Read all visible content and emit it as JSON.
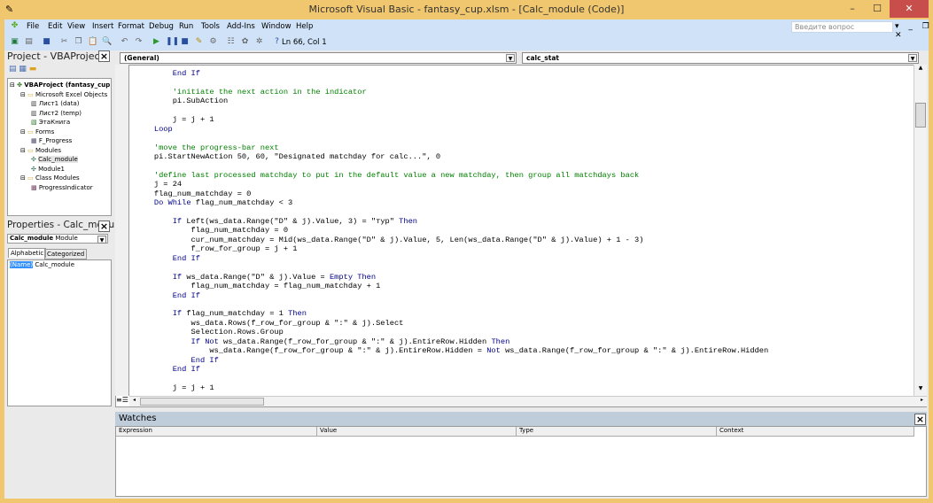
{
  "window": {
    "title": "Microsoft Visual Basic - fantasy_cup.xlsm - [Calc_module (Code)]",
    "minimize": "–",
    "maximize": "☐",
    "close": "✕"
  },
  "menu": [
    "File",
    "Edit",
    "View",
    "Insert",
    "Format",
    "Debug",
    "Run",
    "Tools",
    "Add-Ins",
    "Window",
    "Help"
  ],
  "toolbar": {
    "position": "Ln 66, Col 1",
    "icons": [
      "excel-icon",
      "insert-userform-icon",
      "save-icon",
      "cut-icon",
      "copy-icon",
      "paste-icon",
      "find-icon",
      "undo-icon",
      "redo-icon",
      "run-icon",
      "break-icon",
      "reset-icon",
      "design-mode-icon",
      "project-explorer-icon",
      "properties-icon",
      "object-browser-icon",
      "toolbox-icon",
      "help-icon"
    ]
  },
  "ask": {
    "placeholder": "Введите вопрос"
  },
  "project": {
    "title": "Project - VBAProject",
    "tree": [
      {
        "label": "VBAProject (fantasy_cup",
        "level": 0,
        "bold": true,
        "icon": "vba-project-icon"
      },
      {
        "label": "Microsoft Excel Objects",
        "level": 1,
        "icon": "folder-icon"
      },
      {
        "label": "Лист1 (data)",
        "level": 2,
        "icon": "sheet-icon"
      },
      {
        "label": "Лист2 (temp)",
        "level": 2,
        "icon": "sheet-icon"
      },
      {
        "label": "ЭтаКнига",
        "level": 2,
        "icon": "workbook-icon"
      },
      {
        "label": "Forms",
        "level": 1,
        "icon": "folder-icon"
      },
      {
        "label": "F_Progress",
        "level": 2,
        "icon": "form-icon"
      },
      {
        "label": "Modules",
        "level": 1,
        "icon": "folder-icon"
      },
      {
        "label": "Calc_module",
        "level": 2,
        "icon": "module-icon",
        "selected": true
      },
      {
        "label": "Module1",
        "level": 2,
        "icon": "module-icon"
      },
      {
        "label": "Class Modules",
        "level": 1,
        "icon": "folder-icon"
      },
      {
        "label": "ProgressIndicator",
        "level": 2,
        "icon": "class-module-icon"
      }
    ]
  },
  "properties": {
    "title": "Properties - Calc_modul",
    "object_name": "Calc_module",
    "object_type": "Module",
    "tabs": [
      "Alphabetic",
      "Categorized"
    ],
    "rows": [
      {
        "name": "(Name)",
        "value": "Calc_module"
      }
    ]
  },
  "code": {
    "object": "(General)",
    "procedure": "calc_stat",
    "lines": [
      [
        [
          "kw",
          "        End If"
        ]
      ],
      [],
      [
        [
          "cm",
          "        'initiate the next action in the indicator"
        ]
      ],
      [
        [
          "tx",
          "        pi.SubAction"
        ]
      ],
      [],
      [
        [
          "tx",
          "        j = j + 1"
        ]
      ],
      [
        [
          "kw",
          "    Loop"
        ]
      ],
      [],
      [
        [
          "cm",
          "    'move the progress-bar next"
        ]
      ],
      [
        [
          "tx",
          "    pi.StartNewAction 50, 60, \"Designated matchday for calc...\", 0"
        ]
      ],
      [],
      [
        [
          "cm",
          "    'define last processed matchday to put in the default value a new matchday, then group all matchdays back"
        ]
      ],
      [
        [
          "tx",
          "    j = 24"
        ]
      ],
      [
        [
          "tx",
          "    flag_num_matchday = 0"
        ]
      ],
      [
        [
          "kw",
          "    Do While"
        ],
        [
          "tx",
          " flag_num_matchday < 3"
        ]
      ],
      [],
      [
        [
          "kw",
          "        If"
        ],
        [
          "tx",
          " Left(ws_data.Range(\"D\" & j).Value, 3) = \"тур\" "
        ],
        [
          "kw",
          "Then"
        ]
      ],
      [
        [
          "tx",
          "            flag_num_matchday = 0"
        ]
      ],
      [
        [
          "tx",
          "            cur_num_matchday = Mid(ws_data.Range(\"D\" & j).Value, 5, Len(ws_data.Range(\"D\" & j).Value) + 1 - 3)"
        ]
      ],
      [
        [
          "tx",
          "            f_row_for_group = j + 1"
        ]
      ],
      [
        [
          "kw",
          "        End If"
        ]
      ],
      [],
      [
        [
          "kw",
          "        If"
        ],
        [
          "tx",
          " ws_data.Range(\"D\" & j).Value = "
        ],
        [
          "kw",
          "Empty Then"
        ]
      ],
      [
        [
          "tx",
          "            flag_num_matchday = flag_num_matchday + 1"
        ]
      ],
      [
        [
          "kw",
          "        End If"
        ]
      ],
      [],
      [
        [
          "kw",
          "        If"
        ],
        [
          "tx",
          " flag_num_matchday = 1 "
        ],
        [
          "kw",
          "Then"
        ]
      ],
      [
        [
          "tx",
          "            ws_data.Rows(f_row_for_group & \":\" & j).Select"
        ]
      ],
      [
        [
          "tx",
          "            Selection.Rows.Group"
        ]
      ],
      [
        [
          "kw",
          "            If Not"
        ],
        [
          "tx",
          " ws_data.Range(f_row_for_group & \":\" & j).EntireRow.Hidden "
        ],
        [
          "kw",
          "Then"
        ]
      ],
      [
        [
          "tx",
          "                ws_data.Range(f_row_for_group & \":\" & j).EntireRow.Hidden = "
        ],
        [
          "kw",
          "Not"
        ],
        [
          "tx",
          " ws_data.Range(f_row_for_group & \":\" & j).EntireRow.Hidden"
        ]
      ],
      [
        [
          "kw",
          "            End If"
        ]
      ],
      [
        [
          "kw",
          "        End If"
        ]
      ],
      [],
      [
        [
          "tx",
          "        j = j + 1"
        ]
      ]
    ]
  },
  "watches": {
    "title": "Watches",
    "columns": [
      "Expression",
      "Value",
      "Type",
      "Context"
    ]
  },
  "colors": {
    "frame": "#f0c66e",
    "menubar": "#cfe2f8",
    "keyword": "#00008b",
    "comment": "#008000",
    "watches_title": "#bfcddb"
  }
}
